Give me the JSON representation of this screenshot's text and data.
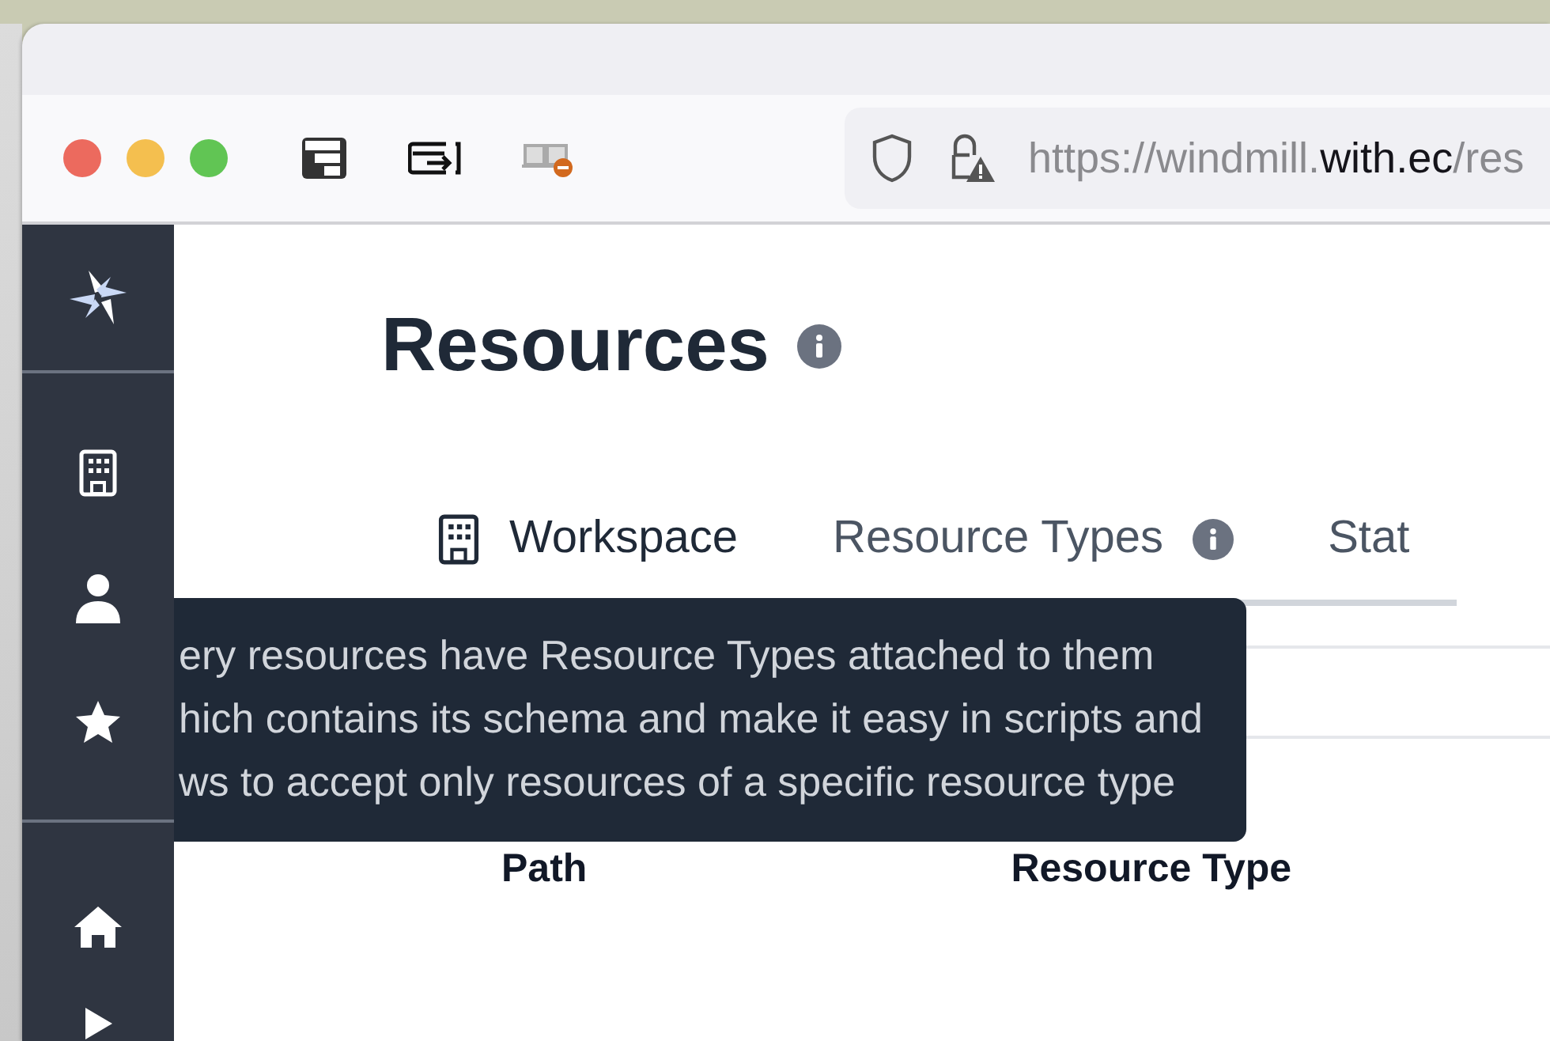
{
  "browser": {
    "url": {
      "host_prefix": "https://windmill.",
      "domain": "with.ec",
      "path": "/res"
    }
  },
  "page": {
    "title": "Resources"
  },
  "tabs": [
    {
      "label": "Workspace",
      "kind": "building",
      "selected": true
    },
    {
      "label": "Resource Types",
      "kind": "info",
      "selected": false
    },
    {
      "label": "Stat",
      "kind": "plain",
      "selected": false
    }
  ],
  "table": {
    "columns": [
      "Path",
      "Resource Type"
    ]
  },
  "tooltip": {
    "lines": [
      "ery resources have Resource Types attached to them",
      "hich contains its schema and make it easy in scripts and",
      "ws to accept only resources of a specific resource type"
    ]
  }
}
